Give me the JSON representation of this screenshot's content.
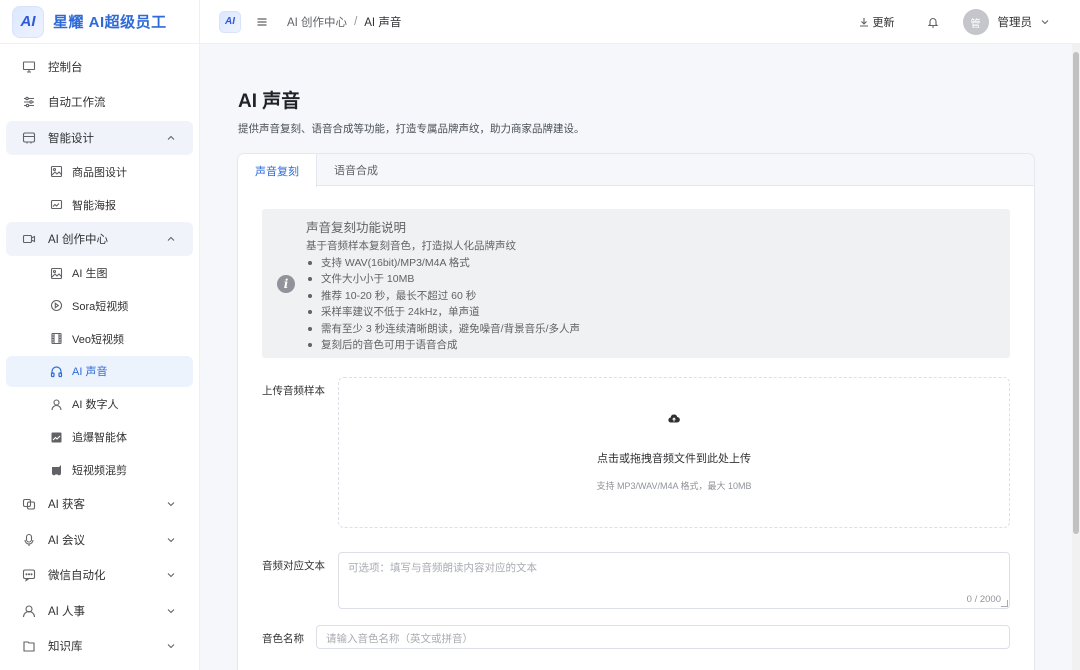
{
  "brand": {
    "logo_text": "AI",
    "name": "星耀 AI超级员工"
  },
  "sidebar": {
    "items": [
      {
        "label": "控制台",
        "icon": "monitor-icon"
      },
      {
        "label": "自动工作流",
        "icon": "sliders-icon"
      },
      {
        "label": "智能设计",
        "icon": "palette-icon",
        "expanded": true,
        "children": [
          {
            "label": "商品图设计",
            "icon": "image-icon"
          },
          {
            "label": "智能海报",
            "icon": "poster-icon"
          }
        ]
      },
      {
        "label": "AI 创作中心",
        "icon": "video-camera-icon",
        "expanded": true,
        "children": [
          {
            "label": "AI 生图",
            "icon": "image-icon"
          },
          {
            "label": "Sora短视频",
            "icon": "play-circle-icon"
          },
          {
            "label": "Veo短视频",
            "icon": "film-icon"
          },
          {
            "label": "AI 声音",
            "icon": "headphones-icon",
            "active": true
          },
          {
            "label": "AI 数字人",
            "icon": "user-icon"
          },
          {
            "label": "追爆智能体",
            "icon": "trending-icon"
          },
          {
            "label": "短视频混剪",
            "icon": "scissors-icon"
          }
        ]
      },
      {
        "label": "AI 获客",
        "icon": "customers-icon"
      },
      {
        "label": "AI 会议",
        "icon": "microphone-icon"
      },
      {
        "label": "微信自动化",
        "icon": "chat-icon"
      },
      {
        "label": "AI 人事",
        "icon": "person-icon"
      },
      {
        "label": "知识库",
        "icon": "book-icon"
      }
    ]
  },
  "header": {
    "logo_text": "AI",
    "breadcrumb": [
      "AI 创作中心",
      "AI 声音"
    ],
    "breadcrumb_sep": "/",
    "update_label": "更新",
    "avatar_text": "管",
    "user_name": "管理员"
  },
  "page": {
    "title": "AI 声音",
    "description": "提供声音复刻、语音合成等功能，打造专属品牌声纹，助力商家品牌建设。"
  },
  "tabs": [
    {
      "label": "声音复刻",
      "active": true
    },
    {
      "label": "语音合成",
      "active": false
    }
  ],
  "info": {
    "icon_text": "i",
    "title": "声音复刻功能说明",
    "subtitle": "基于音频样本复刻音色，打造拟人化品牌声纹",
    "bullets": [
      "支持 WAV(16bit)/MP3/M4A 格式",
      "文件大小小于 10MB",
      "推荐 10-20 秒，最长不超过 60 秒",
      "采样率建议不低于 24kHz，单声道",
      "需有至少 3 秒连续清晰朗读，避免噪音/背景音乐/多人声",
      "复刻后的音色可用于语音合成"
    ]
  },
  "form": {
    "upload_label": "上传音频样本",
    "upload_text": "点击或拖拽音频文件到此处上传",
    "upload_hint": "支持 MP3/WAV/M4A 格式，最大 10MB",
    "text_label": "音频对应文本",
    "text_placeholder": "可选项：填写与音频朗读内容对应的文本",
    "text_count": "0 / 2000",
    "name_label": "音色名称",
    "name_placeholder": "请输入音色名称（英文或拼音）"
  }
}
